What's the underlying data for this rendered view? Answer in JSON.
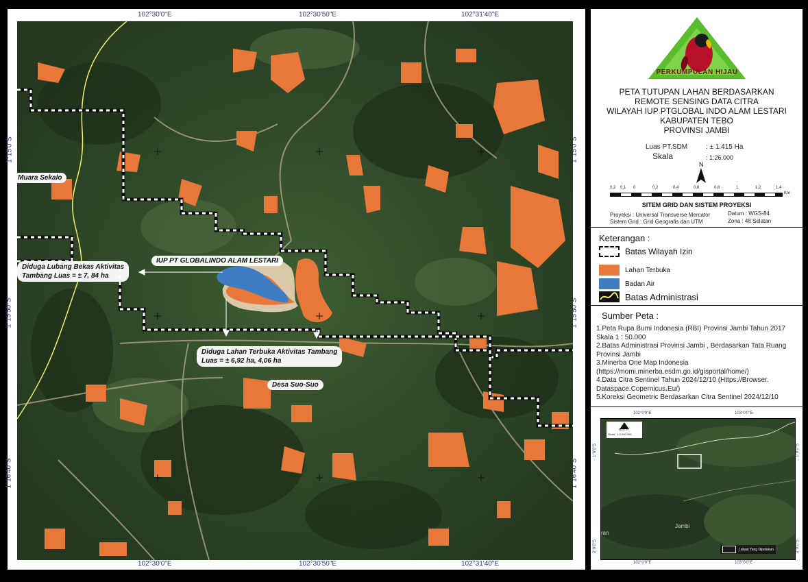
{
  "map": {
    "coords_top": [
      "102°30'0\"E",
      "102°30'50\"E",
      "102°31'40\"E"
    ],
    "coords_bottom": [
      "102°30'0\"E",
      "102°30'50\"E",
      "102°31'40\"E"
    ],
    "coords_left": [
      "1°15'0\"S",
      "1°15'50\"S",
      "1°16'40\"S"
    ],
    "coords_right": [
      "1°15'0\"S",
      "1°15'50\"S",
      "1°16'40\"S"
    ],
    "labels": {
      "muara": "Muara Sekalo",
      "iup": "IUP PT GLOBALINDO ALAM LESTARI",
      "lubang_1": "Diduga Lubang Bekas Aktivitas",
      "lubang_2": "Tambang Luas = ± 7, 84 ha",
      "lahan_1": "Diduga Lahan Terbuka Aktivitas Tambang",
      "lahan_2": "Luas = ± 6,92 ha, 4,06 ha",
      "desa": "Desa Suo-Suo"
    }
  },
  "logo": {
    "text": "PERKUMPULAN HIJAU"
  },
  "title": {
    "line1": "PETA TUTUPAN LAHAN BERDASARKAN",
    "line2": "REMOTE SENSING DATA CITRA",
    "line3": "WILAYAH IUP PTGLOBAL INDO ALAM LESTARI",
    "line4": "KABUPATEN TEBO",
    "line5": "PROVINSI JAMBI"
  },
  "info": {
    "luas_label": "Luas PT.SDM",
    "luas_value": ": ± 1.415 Ha",
    "skala_label": "Skala",
    "skala_value": ": 1:26.000",
    "north": "N",
    "scale_ticks": [
      "0,2",
      "0,1",
      "0",
      "0,2",
      "0,4",
      "0,6",
      "0,8",
      "1",
      "1,2",
      "1,4"
    ],
    "scale_unit": "Km"
  },
  "grid": {
    "heading": "SITEM GRID DAN SISTEM PROYEKSI",
    "proyeksi": "Proyeksi    : Universal Transverse Mercator",
    "sistem": "Sistem Grid  : Grid Geografis dan UTM",
    "datum": "Datum   : WGS-84",
    "zona": "Zona    : 48 Selatan"
  },
  "legend": {
    "heading": "Keterangan :",
    "items": [
      "Batas Wilayah Izin",
      "Lahan Terbuka",
      "Badan Air",
      "Batas Administrasi"
    ],
    "colors": {
      "lahan": "#e8773a",
      "air": "#3e7cc4"
    }
  },
  "sources": {
    "heading": "Sumber Peta  :",
    "items": [
      "1.Peta Rupa Bumi Indonesia (RBI) Provinsi Jambi Tahun 2017 Skala 1 : 50.000",
      "2.Batas Administrasi Provinsi Jambi , Berdasarkan Tata Ruang Provinsi Jambi",
      "3.Minerba One Map Indonesia (https://momi.minerba.esdm.go.id/gisportal/home/)",
      "4.Data Citra Sentinel Tahun 2024/12/10 (Https://Browser. Dataspace.Copernicus.Eu/)",
      "5.Koreksi Geometric Berdasarkan Citra Sentinel 2024/12/10"
    ]
  },
  "inset": {
    "coord_top_1": "102°0'0\"E",
    "coord_top_2": "103°0'0\"E",
    "coord_bottom_1": "102°0'0\"E",
    "coord_bottom_2": "103°0'0\"E",
    "coord_left": "1°0'0\"S",
    "coord_left_2": "2°0'0\"S",
    "coord_right": "1°0'0\"S",
    "coord_right_2": "2°0'0\"S",
    "north": "NORTH",
    "scale": "Skala : 1:3.000.000",
    "place": "Jambi",
    "place2": "ran",
    "legend": "Lokasi Yang Dipetakan"
  }
}
